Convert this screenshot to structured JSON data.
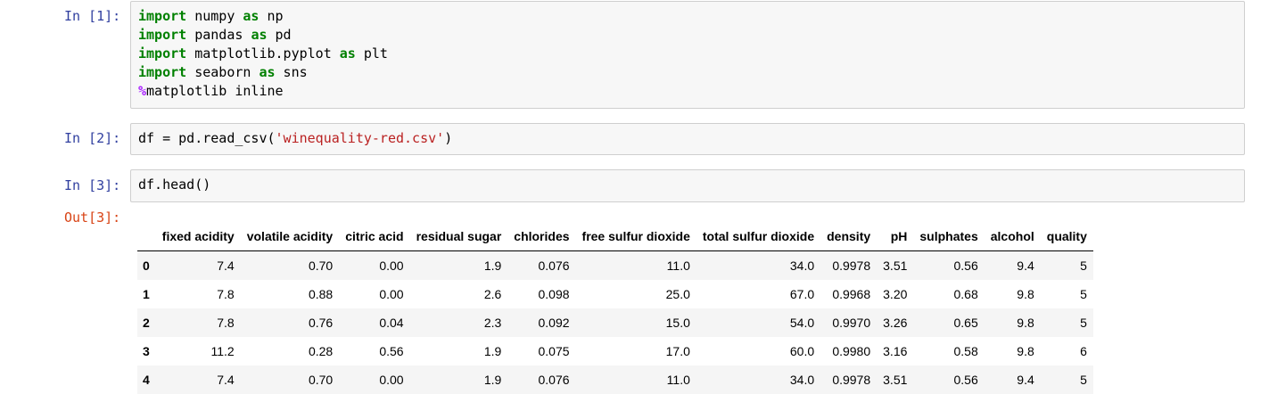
{
  "cells": [
    {
      "prompt": "In [1]:",
      "lines": [
        [
          {
            "t": "import",
            "c": "kw"
          },
          {
            "t": " numpy ",
            "c": ""
          },
          {
            "t": "as",
            "c": "kw"
          },
          {
            "t": " np",
            "c": ""
          }
        ],
        [
          {
            "t": "import",
            "c": "kw"
          },
          {
            "t": " pandas ",
            "c": ""
          },
          {
            "t": "as",
            "c": "kw"
          },
          {
            "t": " pd",
            "c": ""
          }
        ],
        [
          {
            "t": "import",
            "c": "kw"
          },
          {
            "t": " matplotlib.pyplot ",
            "c": ""
          },
          {
            "t": "as",
            "c": "kw"
          },
          {
            "t": " plt",
            "c": ""
          }
        ],
        [
          {
            "t": "import",
            "c": "kw"
          },
          {
            "t": " seaborn ",
            "c": ""
          },
          {
            "t": "as",
            "c": "kw"
          },
          {
            "t": " sns",
            "c": ""
          }
        ],
        [
          {
            "t": "%",
            "c": "mg"
          },
          {
            "t": "matplotlib inline",
            "c": ""
          }
        ]
      ]
    },
    {
      "prompt": "In [2]:",
      "lines": [
        [
          {
            "t": "df = pd.read_csv(",
            "c": ""
          },
          {
            "t": "'winequality-red.csv'",
            "c": "str"
          },
          {
            "t": ")",
            "c": ""
          }
        ]
      ]
    },
    {
      "prompt": "In [3]:",
      "lines": [
        [
          {
            "t": "df.head()",
            "c": ""
          }
        ]
      ]
    }
  ],
  "output": {
    "prompt": "Out[3]:",
    "columns": [
      "",
      "fixed acidity",
      "volatile acidity",
      "citric acid",
      "residual sugar",
      "chlorides",
      "free sulfur dioxide",
      "total sulfur dioxide",
      "density",
      "pH",
      "sulphates",
      "alcohol",
      "quality"
    ],
    "rows": [
      [
        "0",
        "7.4",
        "0.70",
        "0.00",
        "1.9",
        "0.076",
        "11.0",
        "34.0",
        "0.9978",
        "3.51",
        "0.56",
        "9.4",
        "5"
      ],
      [
        "1",
        "7.8",
        "0.88",
        "0.00",
        "2.6",
        "0.098",
        "25.0",
        "67.0",
        "0.9968",
        "3.20",
        "0.68",
        "9.8",
        "5"
      ],
      [
        "2",
        "7.8",
        "0.76",
        "0.04",
        "2.3",
        "0.092",
        "15.0",
        "54.0",
        "0.9970",
        "3.26",
        "0.65",
        "9.8",
        "5"
      ],
      [
        "3",
        "11.2",
        "0.28",
        "0.56",
        "1.9",
        "0.075",
        "17.0",
        "60.0",
        "0.9980",
        "3.16",
        "0.58",
        "9.8",
        "6"
      ],
      [
        "4",
        "7.4",
        "0.70",
        "0.00",
        "1.9",
        "0.076",
        "11.0",
        "34.0",
        "0.9978",
        "3.51",
        "0.56",
        "9.4",
        "5"
      ]
    ]
  },
  "colors": {
    "prompt_in": "#303f9f",
    "prompt_out": "#d84315",
    "keyword": "#008000",
    "magic": "#aa22ff",
    "string": "#ba2121",
    "cell_bg": "#f7f7f7",
    "cell_border": "#cfcfcf"
  }
}
